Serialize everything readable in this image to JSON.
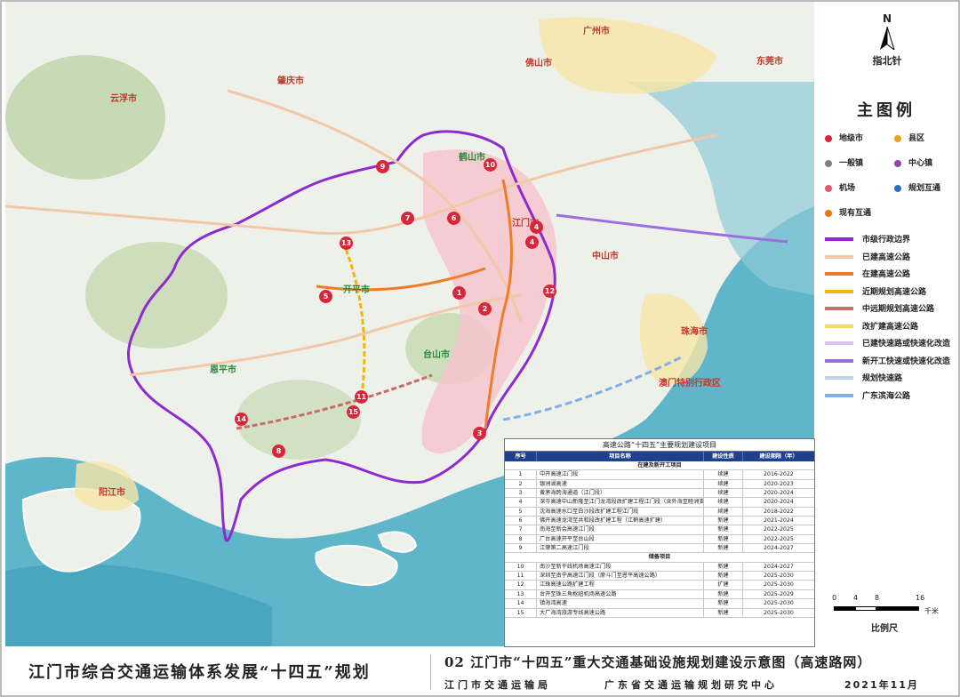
{
  "places": {
    "zhaoqing": "肇庆市",
    "guangzhou": "广州市",
    "foshan": "佛山市",
    "dongguan": "东莞市",
    "yunfu": "云浮市",
    "jiangmen": "江门市",
    "zhongshan": "中山市",
    "zhuhai": "珠海市",
    "macau": "澳门特别行政区",
    "yangjiang": "阳江市",
    "heshan": "鹤山市",
    "taishan": "台山市",
    "kaiping": "开平市",
    "enping": "恩平市"
  },
  "route_badges": [
    "1",
    "2",
    "3",
    "4",
    "4",
    "5",
    "6",
    "7",
    "8",
    "9",
    "10",
    "11",
    "12",
    "13",
    "14",
    "15"
  ],
  "legend": {
    "north_letter": "N",
    "north_label": "指北针",
    "title": "主图例",
    "poi": [
      {
        "label": "地级市",
        "color": "#d6283a"
      },
      {
        "label": "县区",
        "color": "#e8a21a"
      },
      {
        "label": "一般镇",
        "color": "#808080"
      },
      {
        "label": "中心镇",
        "color": "#8e44ad"
      },
      {
        "label": "机场",
        "color": "#e05a6a"
      },
      {
        "label": "规划互通",
        "color": "#2a6fc9"
      },
      {
        "label": "现有互通",
        "color": "#e07b1a"
      }
    ],
    "lines": [
      {
        "label": "市级行政边界",
        "color": "#8e2bd0"
      },
      {
        "label": "已建高速公路",
        "color": "#f2c9a8"
      },
      {
        "label": "在建高速公路",
        "color": "#f07c2a"
      },
      {
        "label": "近期规划高速公路",
        "color": "#f2b705"
      },
      {
        "label": "中远期规划高速公路",
        "color": "#c76b6b"
      },
      {
        "label": "改扩建高速公路",
        "color": "#f7d774"
      },
      {
        "label": "已建快速路或快速化改造",
        "color": "#d9c5f2"
      },
      {
        "label": "新开工快速或快速化改造",
        "color": "#9b6fe0"
      },
      {
        "label": "规划快速路",
        "color": "#bcd3f0"
      },
      {
        "label": "广东滨海公路",
        "color": "#7fb0e6"
      }
    ],
    "scale_ticks": [
      "0",
      "4",
      "8",
      "16"
    ],
    "scale_unit": "千米",
    "scale_caption": "比例尺"
  },
  "table": {
    "caption": "高速公路“十四五”主要规划建设项目",
    "headers": [
      "序号",
      "项目名称",
      "建设性质",
      "建设期限（年）"
    ],
    "section1": "在建及新开工项目",
    "section2": "储备项目",
    "rows1": [
      [
        "1",
        "中开高速江门段",
        "续建",
        "2016-2022"
      ],
      [
        "2",
        "银洲湖高速",
        "续建",
        "2020-2023"
      ],
      [
        "3",
        "黄茅海跨海通道（江门段）",
        "续建",
        "2020-2024"
      ],
      [
        "4",
        "深岑高速中山新隆至江门龙湾段改扩建工程江门段（含外海至睦洲支线）",
        "续建",
        "2020-2024"
      ],
      [
        "5",
        "沈海高速水口至白沙段改扩建工程江门段",
        "续建",
        "2018-2022"
      ],
      [
        "6",
        "佛开高速龙湾至共和段改扩建工程（江鹤高速扩建）",
        "新建",
        "2021-2024"
      ],
      [
        "7",
        "南海至新会高速江门段",
        "新建",
        "2022-2025"
      ],
      [
        "8",
        "广台高速开平至台山段",
        "新建",
        "2022-2025"
      ],
      [
        "9",
        "江肇第二高速江门段",
        "新建",
        "2024-2027"
      ]
    ],
    "rows2": [
      [
        "10",
        "南沙至新干线机场高速江门段",
        "新建",
        "2024-2027"
      ],
      [
        "11",
        "深圳至南宁高速江门段（原斗门至恩平高速公路）",
        "新建",
        "2025-2030"
      ],
      [
        "12",
        "江珠高速公路扩建工程",
        "扩建",
        "2025-2030"
      ],
      [
        "13",
        "台开至珠三角枢纽机场高速公路",
        "新建",
        "2025-2029"
      ],
      [
        "14",
        "镇海湾高速",
        "新建",
        "2025-2030"
      ],
      [
        "15",
        "大广海湾旅游专线高速公路",
        "新建",
        "2025-2030"
      ]
    ]
  },
  "footer": {
    "left_title": "江门市综合交通运输体系发展“十四五”规划",
    "right_title": "02 江门市“十四五”重大交通基础设施规划建设示意图（高速路网）",
    "org1": "江门市交通运输局",
    "org2": "广东省交通运输规划研究中心",
    "date": "2021年11月"
  },
  "colors": {
    "sea": "#5fb5c9",
    "land": "#eef0ea",
    "urban": "#f4c6cc",
    "boundary": "#8e2bd0",
    "badge": "#d6283a",
    "table_header": "#1f3f8f"
  }
}
